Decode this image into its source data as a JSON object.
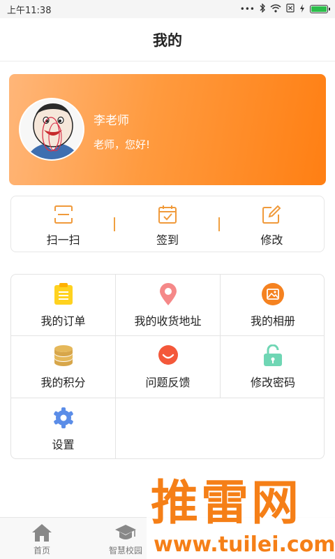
{
  "status_bar": {
    "time": "上午11:38"
  },
  "header": {
    "title": "我的"
  },
  "profile": {
    "name": "李老师",
    "greeting": "老师，您好!"
  },
  "quick_actions": [
    {
      "label": "扫一扫",
      "icon": "scan-icon"
    },
    {
      "label": "签到",
      "icon": "check-in-icon"
    },
    {
      "label": "修改",
      "icon": "edit-icon"
    }
  ],
  "menu": [
    {
      "label": "我的订单",
      "icon": "order-icon"
    },
    {
      "label": "我的收货地址",
      "icon": "location-pin-icon"
    },
    {
      "label": "我的相册",
      "icon": "album-icon"
    },
    {
      "label": "我的积分",
      "icon": "coins-icon"
    },
    {
      "label": "问题反馈",
      "icon": "feedback-icon"
    },
    {
      "label": "修改密码",
      "icon": "unlock-icon"
    },
    {
      "label": "设置",
      "icon": "settings-gear-icon"
    }
  ],
  "tab_bar": [
    {
      "label": "首页",
      "icon": "home-icon"
    },
    {
      "label": "智慧校园",
      "icon": "graduation-cap-icon"
    }
  ],
  "watermark": {
    "text": "推雷网",
    "url": "www.tuilei.com"
  },
  "colors": {
    "accent": "#ff8a1f",
    "card_start": "#ffb679",
    "card_end": "#ff7f13"
  }
}
